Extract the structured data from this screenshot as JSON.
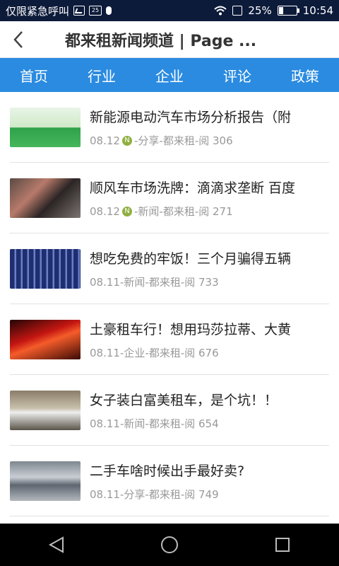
{
  "status_bar": {
    "carrier_text": "仅限紧急呼叫",
    "badge_text": "25",
    "battery_percent": "25%",
    "battery_level": 0.25,
    "time": "10:54"
  },
  "header": {
    "back_icon": "chevron-left-icon",
    "title": "都来租新闻频道 | Page ..."
  },
  "tabs": [
    "首页",
    "行业",
    "企业",
    "评论",
    "政策"
  ],
  "articles": [
    {
      "title": "新能源电动汽车市场分析报告（附",
      "date": "08.12",
      "is_new": true,
      "category": "分享",
      "source": "都来租",
      "views": "阅 306"
    },
    {
      "title": "顺风车市场洗牌：滴滴求垄断 百度",
      "date": "08.12",
      "is_new": true,
      "category": "新闻",
      "source": "都来租",
      "views": "阅 271"
    },
    {
      "title": "想吃免费的牢饭！三个月骗得五辆",
      "date": "08.11",
      "is_new": false,
      "category": "新闻",
      "source": "都来租",
      "views": "阅 733"
    },
    {
      "title": "土豪租车行！想用玛莎拉蒂、大黄",
      "date": "08.11",
      "is_new": false,
      "category": "企业",
      "source": "都来租",
      "views": "阅 676"
    },
    {
      "title": "女子装白富美租车，是个坑！！",
      "date": "08.11",
      "is_new": false,
      "category": "新闻",
      "source": "都来租",
      "views": "阅 654"
    },
    {
      "title": "二手车啥时候出手最好卖?",
      "date": "08.11",
      "is_new": false,
      "category": "分享",
      "source": "都来租",
      "views": "阅 749"
    }
  ],
  "meta_separator": " - ",
  "new_badge_text": "N",
  "nav_bar": {
    "icons": [
      "back-triangle-icon",
      "home-circle-icon",
      "recents-square-icon"
    ]
  },
  "colors": {
    "status_bar": "#0d1b3a",
    "tab_bar": "#2a8be0",
    "nav_bar": "#000000",
    "meta_text": "#999999"
  }
}
